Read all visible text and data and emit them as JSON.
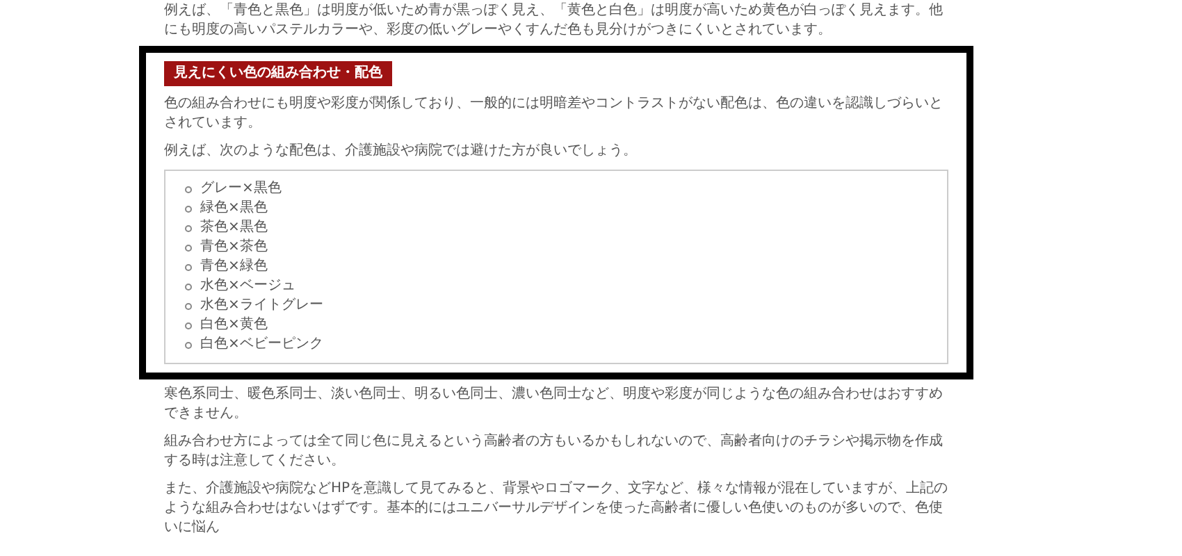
{
  "intro_paragraph": "例えば、「青色と黒色」は明度が低いため青が黒っぽく見え、「黄色と白色」は明度が高いため黄色が白っぽく見えます。他にも明度の高いパステルカラーや、彩度の低いグレーやくすんだ色も見分けがつきにくいとされています。",
  "section": {
    "heading": "見えにくい色の組み合わせ・配色",
    "paragraphs": [
      "色の組み合わせにも明度や彩度が関係しており、一般的には明暗差やコントラストがない配色は、色の違いを認識しづらいとされています。",
      "例えば、次のような配色は、介護施設や病院では避けた方が良いでしょう。"
    ],
    "list": [
      "グレー×黒色",
      "緑色×黒色",
      "茶色×黒色",
      "青色×茶色",
      "青色×緑色",
      "水色×ベージュ",
      "水色×ライトグレー",
      "白色×黄色",
      "白色×ベビーピンク"
    ]
  },
  "paragraphs": [
    "寒色系同士、暖色系同士、淡い色同士、明るい色同士、濃い色同士など、明度や彩度が同じような色の組み合わせはおすすめできません。",
    "組み合わせ方によっては全て同じ色に見えるという高齢者の方もいるかもしれないので、高齢者向けのチラシや掲示物を作成する時は注意してください。",
    "また、介護施設や病院などHPを意識して見てみると、背景やロゴマーク、文字など、様々な情報が混在していますが、上記のような組み合わせはないはずです。基本的にはユニバーサルデザインを使った高齢者に優しい色使いのものが多いので、色使いに悩ん"
  ]
}
